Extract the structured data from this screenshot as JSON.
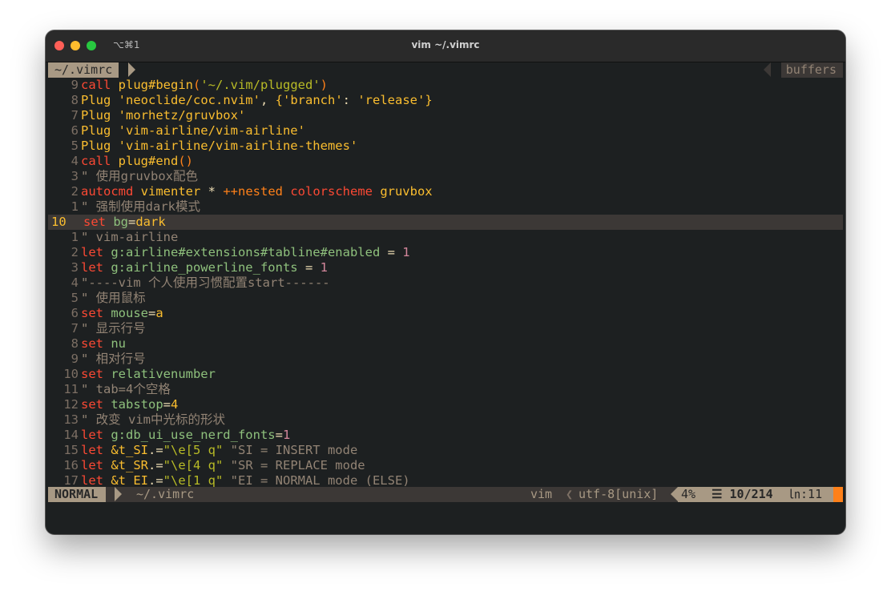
{
  "window": {
    "title": "vim ~/.vimrc",
    "shortcut": "⌥⌘1"
  },
  "tabline": {
    "file": "~/.vimrc",
    "buffers": "buffers"
  },
  "lines": [
    {
      "num": "9",
      "segs": [
        [
          "call ",
          "k"
        ],
        [
          "plug#begin",
          "f"
        ],
        [
          "(",
          "o"
        ],
        [
          "'~/.vim/plugged'",
          "s"
        ],
        [
          ")",
          "o"
        ]
      ]
    },
    {
      "num": "8",
      "segs": [
        [
          "Plug ",
          "f"
        ],
        [
          "'neoclide/coc.nvim'",
          "f"
        ],
        [
          ", ",
          "w"
        ],
        [
          "{",
          "f"
        ],
        [
          "'branch'",
          "f"
        ],
        [
          ": ",
          "w"
        ],
        [
          "'release'",
          "f"
        ],
        [
          "}",
          "f"
        ]
      ]
    },
    {
      "num": "7",
      "segs": [
        [
          "Plug 'morhetz/gruvbox'",
          "f"
        ]
      ]
    },
    {
      "num": "6",
      "segs": [
        [
          "Plug 'vim-airline/vim-airline'",
          "f"
        ]
      ]
    },
    {
      "num": "5",
      "segs": [
        [
          "Plug 'vim-airline/vim-airline-themes'",
          "f"
        ]
      ]
    },
    {
      "num": "4",
      "segs": [
        [
          "call ",
          "k"
        ],
        [
          "plug#end",
          "f"
        ],
        [
          "()",
          "o"
        ]
      ]
    },
    {
      "num": "3",
      "segs": [
        [
          "\" 使用gruvbox配色",
          "c"
        ]
      ]
    },
    {
      "num": "2",
      "segs": [
        [
          "autocmd ",
          "k"
        ],
        [
          "vimenter ",
          "f"
        ],
        [
          "* ",
          "w"
        ],
        [
          "++nested ",
          "o"
        ],
        [
          "colorscheme ",
          "k"
        ],
        [
          "gruvbox",
          "f"
        ]
      ]
    },
    {
      "num": "1",
      "segs": [
        [
          "\" 强制使用dark模式",
          "c"
        ]
      ]
    },
    {
      "num": "10",
      "cursor": true,
      "segs": [
        [
          "set ",
          "k"
        ],
        [
          "bg",
          "v"
        ],
        [
          "=",
          "w"
        ],
        [
          "dark",
          "f"
        ]
      ]
    },
    {
      "num": "1",
      "segs": [
        [
          "\" vim-airline",
          "c"
        ]
      ]
    },
    {
      "num": "2",
      "segs": [
        [
          "let ",
          "k"
        ],
        [
          "g:airline#extensions#tabline#enabled",
          "v"
        ],
        [
          " = ",
          "w"
        ],
        [
          "1",
          "n"
        ]
      ]
    },
    {
      "num": "3",
      "segs": [
        [
          "let ",
          "k"
        ],
        [
          "g:airline_powerline_fonts",
          "v"
        ],
        [
          " = ",
          "w"
        ],
        [
          "1",
          "n"
        ]
      ]
    },
    {
      "num": "4",
      "segs": [
        [
          "\"----vim 个人使用习惯配置start------",
          "c"
        ]
      ]
    },
    {
      "num": "5",
      "segs": [
        [
          "\" 使用鼠标",
          "c"
        ]
      ]
    },
    {
      "num": "6",
      "segs": [
        [
          "set ",
          "k"
        ],
        [
          "mouse",
          "v"
        ],
        [
          "=",
          "w"
        ],
        [
          "a",
          "f"
        ]
      ]
    },
    {
      "num": "7",
      "segs": [
        [
          "\" 显示行号",
          "c"
        ]
      ]
    },
    {
      "num": "8",
      "segs": [
        [
          "set ",
          "k"
        ],
        [
          "nu",
          "v"
        ]
      ]
    },
    {
      "num": "9",
      "segs": [
        [
          "\" 相对行号",
          "c"
        ]
      ]
    },
    {
      "num": "10",
      "segs": [
        [
          "set ",
          "k"
        ],
        [
          "relativenumber",
          "v"
        ]
      ]
    },
    {
      "num": "11",
      "segs": [
        [
          "\" tab=4个空格",
          "c"
        ]
      ]
    },
    {
      "num": "12",
      "segs": [
        [
          "set ",
          "k"
        ],
        [
          "tabstop",
          "v"
        ],
        [
          "=",
          "w"
        ],
        [
          "4",
          "f"
        ]
      ]
    },
    {
      "num": "13",
      "segs": [
        [
          "\" 改变 vim中光标的形状",
          "c"
        ]
      ]
    },
    {
      "num": "14",
      "segs": [
        [
          "let ",
          "k"
        ],
        [
          "g:db_ui_use_nerd_fonts",
          "v"
        ],
        [
          "=",
          "w"
        ],
        [
          "1",
          "n"
        ]
      ]
    },
    {
      "num": "15",
      "segs": [
        [
          "let ",
          "k"
        ],
        [
          "&t_SI",
          "f"
        ],
        [
          ".=",
          "w"
        ],
        [
          "\"\\e[5 q\"",
          "s"
        ],
        [
          " \"SI = INSERT mode",
          "c"
        ]
      ]
    },
    {
      "num": "16",
      "segs": [
        [
          "let ",
          "k"
        ],
        [
          "&t_SR",
          "f"
        ],
        [
          ".=",
          "w"
        ],
        [
          "\"\\e[4 q\"",
          "s"
        ],
        [
          " \"SR = REPLACE mode",
          "c"
        ]
      ]
    },
    {
      "num": "17",
      "segs": [
        [
          "let ",
          "k"
        ],
        [
          "&t_EI",
          "f"
        ],
        [
          ".=",
          "w"
        ],
        [
          "\"\\e[1 q\"",
          "s"
        ],
        [
          " \"EI = NORMAL mode (ELSE)",
          "c"
        ]
      ]
    }
  ],
  "statusline": {
    "mode": "NORMAL",
    "file": "~/.vimrc",
    "filetype": "vim",
    "encoding": "utf-8[unix]",
    "percent": "4%",
    "line_icon": "☰",
    "line": "10/214",
    "col_icon": "㏑",
    "col": ":11"
  },
  "colors": {
    "k": "#fb4934",
    "f": "#fabd2f",
    "s": "#b8bb26",
    "o": "#fe8019",
    "c": "#928374",
    "n": "#d3869b",
    "v": "#8ec07c",
    "w": "#ebdbb2"
  }
}
